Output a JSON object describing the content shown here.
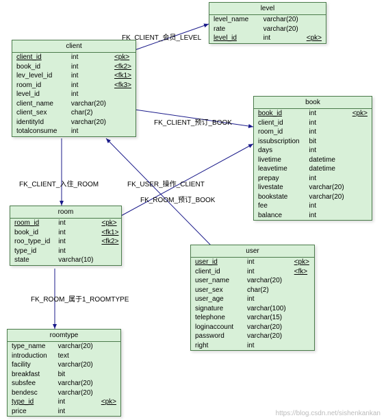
{
  "entities": {
    "level": {
      "title": "level",
      "rows": [
        {
          "name": "level_name",
          "type": "varchar(20)",
          "key": ""
        },
        {
          "name": "rate",
          "type": "varchar(20)",
          "key": ""
        },
        {
          "name": "level_id",
          "type": "int",
          "key": "<pk>",
          "pk": true
        }
      ]
    },
    "client": {
      "title": "client",
      "rows": [
        {
          "name": "client_id",
          "type": "int",
          "key": "<pk>",
          "pk": true
        },
        {
          "name": "book_id",
          "type": "int",
          "key": "<fk2>"
        },
        {
          "name": "lev_level_id",
          "type": "int",
          "key": "<fk1>"
        },
        {
          "name": "room_id",
          "type": "int",
          "key": "<fk3>"
        },
        {
          "name": "level_id",
          "type": "int",
          "key": ""
        },
        {
          "name": "client_name",
          "type": "varchar(20)",
          "key": ""
        },
        {
          "name": "client_sex",
          "type": "char(2)",
          "key": ""
        },
        {
          "name": "identityId",
          "type": "varchar(20)",
          "key": ""
        },
        {
          "name": "totalconsume",
          "type": "int",
          "key": ""
        }
      ]
    },
    "book": {
      "title": "book",
      "rows": [
        {
          "name": "book_id",
          "type": "int",
          "key": "<pk>",
          "pk": true
        },
        {
          "name": "client_id",
          "type": "int",
          "key": ""
        },
        {
          "name": "room_id",
          "type": "int",
          "key": ""
        },
        {
          "name": "issubscription",
          "type": "bit",
          "key": ""
        },
        {
          "name": "days",
          "type": "int",
          "key": ""
        },
        {
          "name": "livetime",
          "type": "datetime",
          "key": ""
        },
        {
          "name": "leavetime",
          "type": "datetime",
          "key": ""
        },
        {
          "name": "prepay",
          "type": "int",
          "key": ""
        },
        {
          "name": "livestate",
          "type": "varchar(20)",
          "key": ""
        },
        {
          "name": "bookstate",
          "type": "varchar(20)",
          "key": ""
        },
        {
          "name": "fee",
          "type": "int",
          "key": ""
        },
        {
          "name": "balance",
          "type": "int",
          "key": ""
        }
      ]
    },
    "room": {
      "title": "room",
      "rows": [
        {
          "name": "room_id",
          "type": "int",
          "key": "<pk>",
          "pk": true
        },
        {
          "name": "book_id",
          "type": "int",
          "key": "<fk1>"
        },
        {
          "name": "roo_type_id",
          "type": "int",
          "key": "<fk2>"
        },
        {
          "name": "type_id",
          "type": "int",
          "key": ""
        },
        {
          "name": "state",
          "type": "varchar(10)",
          "key": ""
        }
      ]
    },
    "user": {
      "title": "user",
      "rows": [
        {
          "name": "user_id",
          "type": "int",
          "key": "<pk>",
          "pk": true
        },
        {
          "name": "client_id",
          "type": "int",
          "key": "<fk>"
        },
        {
          "name": "user_name",
          "type": "varchar(20)",
          "key": ""
        },
        {
          "name": "user_sex",
          "type": "char(2)",
          "key": ""
        },
        {
          "name": "user_age",
          "type": "int",
          "key": ""
        },
        {
          "name": "signature",
          "type": "varchar(100)",
          "key": ""
        },
        {
          "name": "telephone",
          "type": "varchar(15)",
          "key": ""
        },
        {
          "name": "loginaccount",
          "type": "varchar(20)",
          "key": ""
        },
        {
          "name": "password",
          "type": "varchar(20)",
          "key": ""
        },
        {
          "name": "right",
          "type": "int",
          "key": ""
        }
      ]
    },
    "roomtype": {
      "title": "roomtype",
      "rows": [
        {
          "name": "type_name",
          "type": "varchar(20)",
          "key": ""
        },
        {
          "name": "introduction",
          "type": "text",
          "key": ""
        },
        {
          "name": "facility",
          "type": "varchar(20)",
          "key": ""
        },
        {
          "name": "breakfast",
          "type": "bit",
          "key": ""
        },
        {
          "name": "subsfee",
          "type": "varchar(20)",
          "key": ""
        },
        {
          "name": "bendesc",
          "type": "varchar(20)",
          "key": ""
        },
        {
          "name": "type_id",
          "type": "int",
          "key": "<pk>",
          "pk": true
        },
        {
          "name": "price",
          "type": "int",
          "key": ""
        }
      ]
    }
  },
  "relations": {
    "client_level": "FK_CLIENT_会员_LEVEL",
    "client_book": "FK_CLIENT_预订_BOOK",
    "client_room": "FK_CLIENT_入住_ROOM",
    "user_client": "FK_USER_操作_CLIENT",
    "room_book": "FK_ROOM_预订_BOOK",
    "room_roomtype": "FK_ROOM_属于1_ROOMTYPE"
  },
  "watermark": "https://blog.csdn.net/sishenkankan"
}
